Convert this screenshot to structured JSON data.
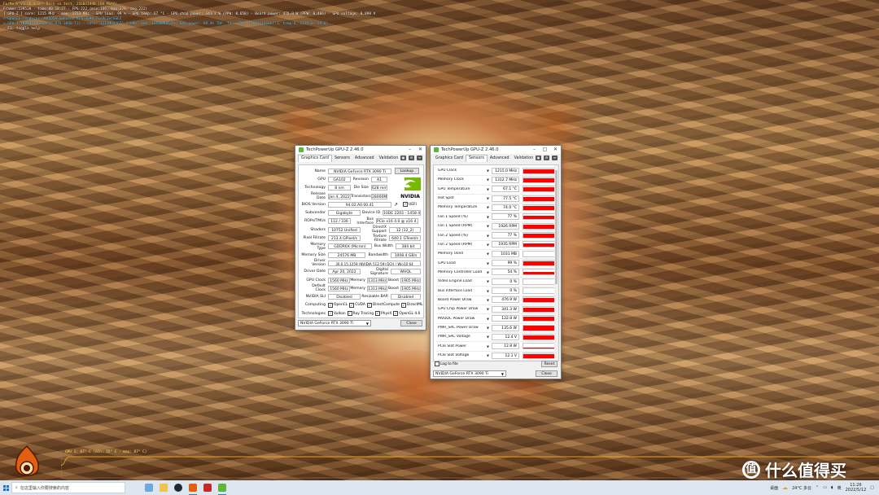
{
  "overlay": {
    "lines": [
      "FurMark v1.26.0.0 - Burn-in test, 2560x1440 (8X MSAA)",
      "Frames:139528 - time:00:18:27 - FPS:222 (min:166, max:279, avg:222)",
      "[ GPU-Z ] core: 1215 MHz - mem: 1313 MHz - GPU load: 99 % - GPU temp: 67 °C - GPU chip power: 341.3 W (PPW: 0.650) - Board power: 476.9 W (PPW: 0.466) - GPU voltage: 0.898 V",
      "> OpenGL renderer: NVIDIA GeForce RTX 3090 Ti/PCIe/SSE2",
      "> GPU 1 (NVIDIA GeForce RTX 3090 Ti) - core: 1215MHz/67° C/99%, mem: 10500MHz/4%, GPU power: 98.4% TDP, fan: 77%, limits(power:1, temp:0, volt:0, OV:0)",
      "- F1: toggle help"
    ],
    "graph_label": "GPU 1: 67° C (min: 55° C - max: 67° C)"
  },
  "gpuz_card": {
    "title": "TechPowerUp GPU-Z 2.46.0",
    "tabs": [
      "Graphics Card",
      "Sensors",
      "Advanced",
      "Validation"
    ],
    "active_tab": "Graphics Card",
    "name_label": "Name",
    "name_value": "NVIDIA GeForce RTX 3090 Ti",
    "lookup_button": "Lookup",
    "gpu_label": "GPU",
    "gpu_value": "GA102",
    "revision_label": "Revision",
    "revision_value": "A1",
    "technology_label": "Technology",
    "technology_value": "8 nm",
    "diesize_label": "Die Size",
    "diesize_value": "628 mm²",
    "release_label": "Release Date",
    "release_value": "Jan 4, 2022",
    "transistors_label": "Transistors",
    "transistors_value": "28000M",
    "bios_label": "BIOS Version",
    "bios_value": "94.02.A0.00.41",
    "uefi_label": "UEFI",
    "subvendor_label": "Subvendor",
    "subvendor_value": "Gigabyte",
    "deviceid_label": "Device ID",
    "deviceid_value": "10DE 2203 - 1458 4046",
    "rops_label": "ROPs/TMUs",
    "rops_value": "112 / 336",
    "businterface_label": "Bus Interface",
    "businterface_value": "PCIe x16 4.0 @ x16 4.0",
    "shaders_label": "Shaders",
    "shaders_value": "10752 Unified",
    "directx_label": "DirectX Support",
    "directx_value": "12 (12_2)",
    "pixel_label": "Pixel Fillrate",
    "pixel_value": "213.4 GPixel/s",
    "texture_label": "Texture Fillrate",
    "texture_value": "640.1 GTexel/s",
    "memtype_label": "Memory Type",
    "memtype_value": "GDDR6X (Micron)",
    "buswidth_label": "Bus Width",
    "buswidth_value": "384 bit",
    "memsize_label": "Memory Size",
    "memsize_value": "24576 MB",
    "bandwidth_label": "Bandwidth",
    "bandwidth_value": "1008.4 GB/s",
    "driverver_label": "Driver Version",
    "driverver_value": "30.0.15.1259 (NVIDIA 512.59) DCH / Win10 64",
    "driverdate_label": "Driver Date",
    "driverdate_value": "Apr 20, 2022",
    "digsig_label": "Digital Signature",
    "digsig_value": "WHQL",
    "gpuclock_label": "GPU Clock",
    "gpuclock_value": "1560 MHz",
    "memory_label": "Memory",
    "memory_value": "1313 MHz",
    "boost_label": "Boost",
    "boost_value": "1905 MHz",
    "defclock_label": "Default Clock",
    "defclock_value": "1560 MHz",
    "defmemory_value": "1313 MHz",
    "defboost_value": "1905 MHz",
    "sli_label": "NVIDIA SLI",
    "sli_value": "Disabled",
    "rebar_label": "Resizable BAR",
    "rebar_value": "Disabled",
    "computing_label": "Computing",
    "computing_items": [
      "OpenCL",
      "CUDA",
      "DirectCompute",
      "DirectML"
    ],
    "technologies_label": "Technologies",
    "technologies_items": [
      "Vulkan",
      "Ray Tracing",
      "PhysX",
      "OpenGL 4.6"
    ],
    "gpu_select": "NVIDIA GeForce RTX 3090 Ti",
    "close_button": "Close",
    "nvidia_logo_text": "NVIDIA"
  },
  "gpuz_sensors": {
    "title": "TechPowerUp GPU-Z 2.46.0",
    "tabs": [
      "Graphics Card",
      "Sensors",
      "Advanced",
      "Validation"
    ],
    "active_tab": "Sensors",
    "sensors": [
      {
        "name": "GPU Clock",
        "value": "1215.0 MHz",
        "level": 0.75
      },
      {
        "name": "Memory Clock",
        "value": "1312.7 MHz",
        "level": 0.85
      },
      {
        "name": "GPU Temperature",
        "value": "67.1 °C",
        "level": 0.8
      },
      {
        "name": "Hot Spot",
        "value": "77.5 °C",
        "level": 0.85
      },
      {
        "name": "Memory Temperature",
        "value": "74.0 °C",
        "level": 0.82
      },
      {
        "name": "Fan 1 Speed (%)",
        "value": "77 %",
        "level": 0.8
      },
      {
        "name": "Fan 1 Speed (RPM)",
        "value": "1926 RPM",
        "level": 0.8
      },
      {
        "name": "Fan 2 Speed (%)",
        "value": "77 %",
        "level": 0.8
      },
      {
        "name": "Fan 2 Speed (RPM)",
        "value": "1935 RPM",
        "level": 0.8
      },
      {
        "name": "Memory Used",
        "value": "1031 MB",
        "level": 0.0
      },
      {
        "name": "GPU Load",
        "value": "99 %",
        "level": 0.9
      },
      {
        "name": "Memory Controller Load",
        "value": "54 %",
        "level": 0.6
      },
      {
        "name": "Video Engine Load",
        "value": "0 %",
        "level": 0.0
      },
      {
        "name": "Bus Interface Load",
        "value": "0 %",
        "level": 0.0
      },
      {
        "name": "Board Power Draw",
        "value": "476.9 W",
        "level": 0.85
      },
      {
        "name": "GPU Chip Power Draw",
        "value": "341.3 W",
        "level": 0.85
      },
      {
        "name": "MVDDC Power Draw",
        "value": "122.8 W",
        "level": 0.85
      },
      {
        "name": "PWR_SRC Power Draw",
        "value": "135.6 W",
        "level": 0.85
      },
      {
        "name": "PWR_SRC Voltage",
        "value": "12.4 V",
        "level": 0.85
      },
      {
        "name": "PCIe Slot Power",
        "value": "12.8 W",
        "level": 0.25
      },
      {
        "name": "PCIe Slot Voltage",
        "value": "12.1 V",
        "level": 0.85
      }
    ],
    "log_label": "Log to file",
    "reset_button": "Reset",
    "gpu_select": "NVIDIA GeForce RTX 3090 Ti",
    "close_button": "Close"
  },
  "taskbar": {
    "search_placeholder": "在这里输入你要搜索的内容",
    "tray_weather": "24°C 多云",
    "tray_lang": "英",
    "tray_desktop": "桌面",
    "time": "11:26",
    "date": "2022/5/12"
  },
  "watermark": {
    "icon": "值",
    "text": "什么值得买"
  }
}
